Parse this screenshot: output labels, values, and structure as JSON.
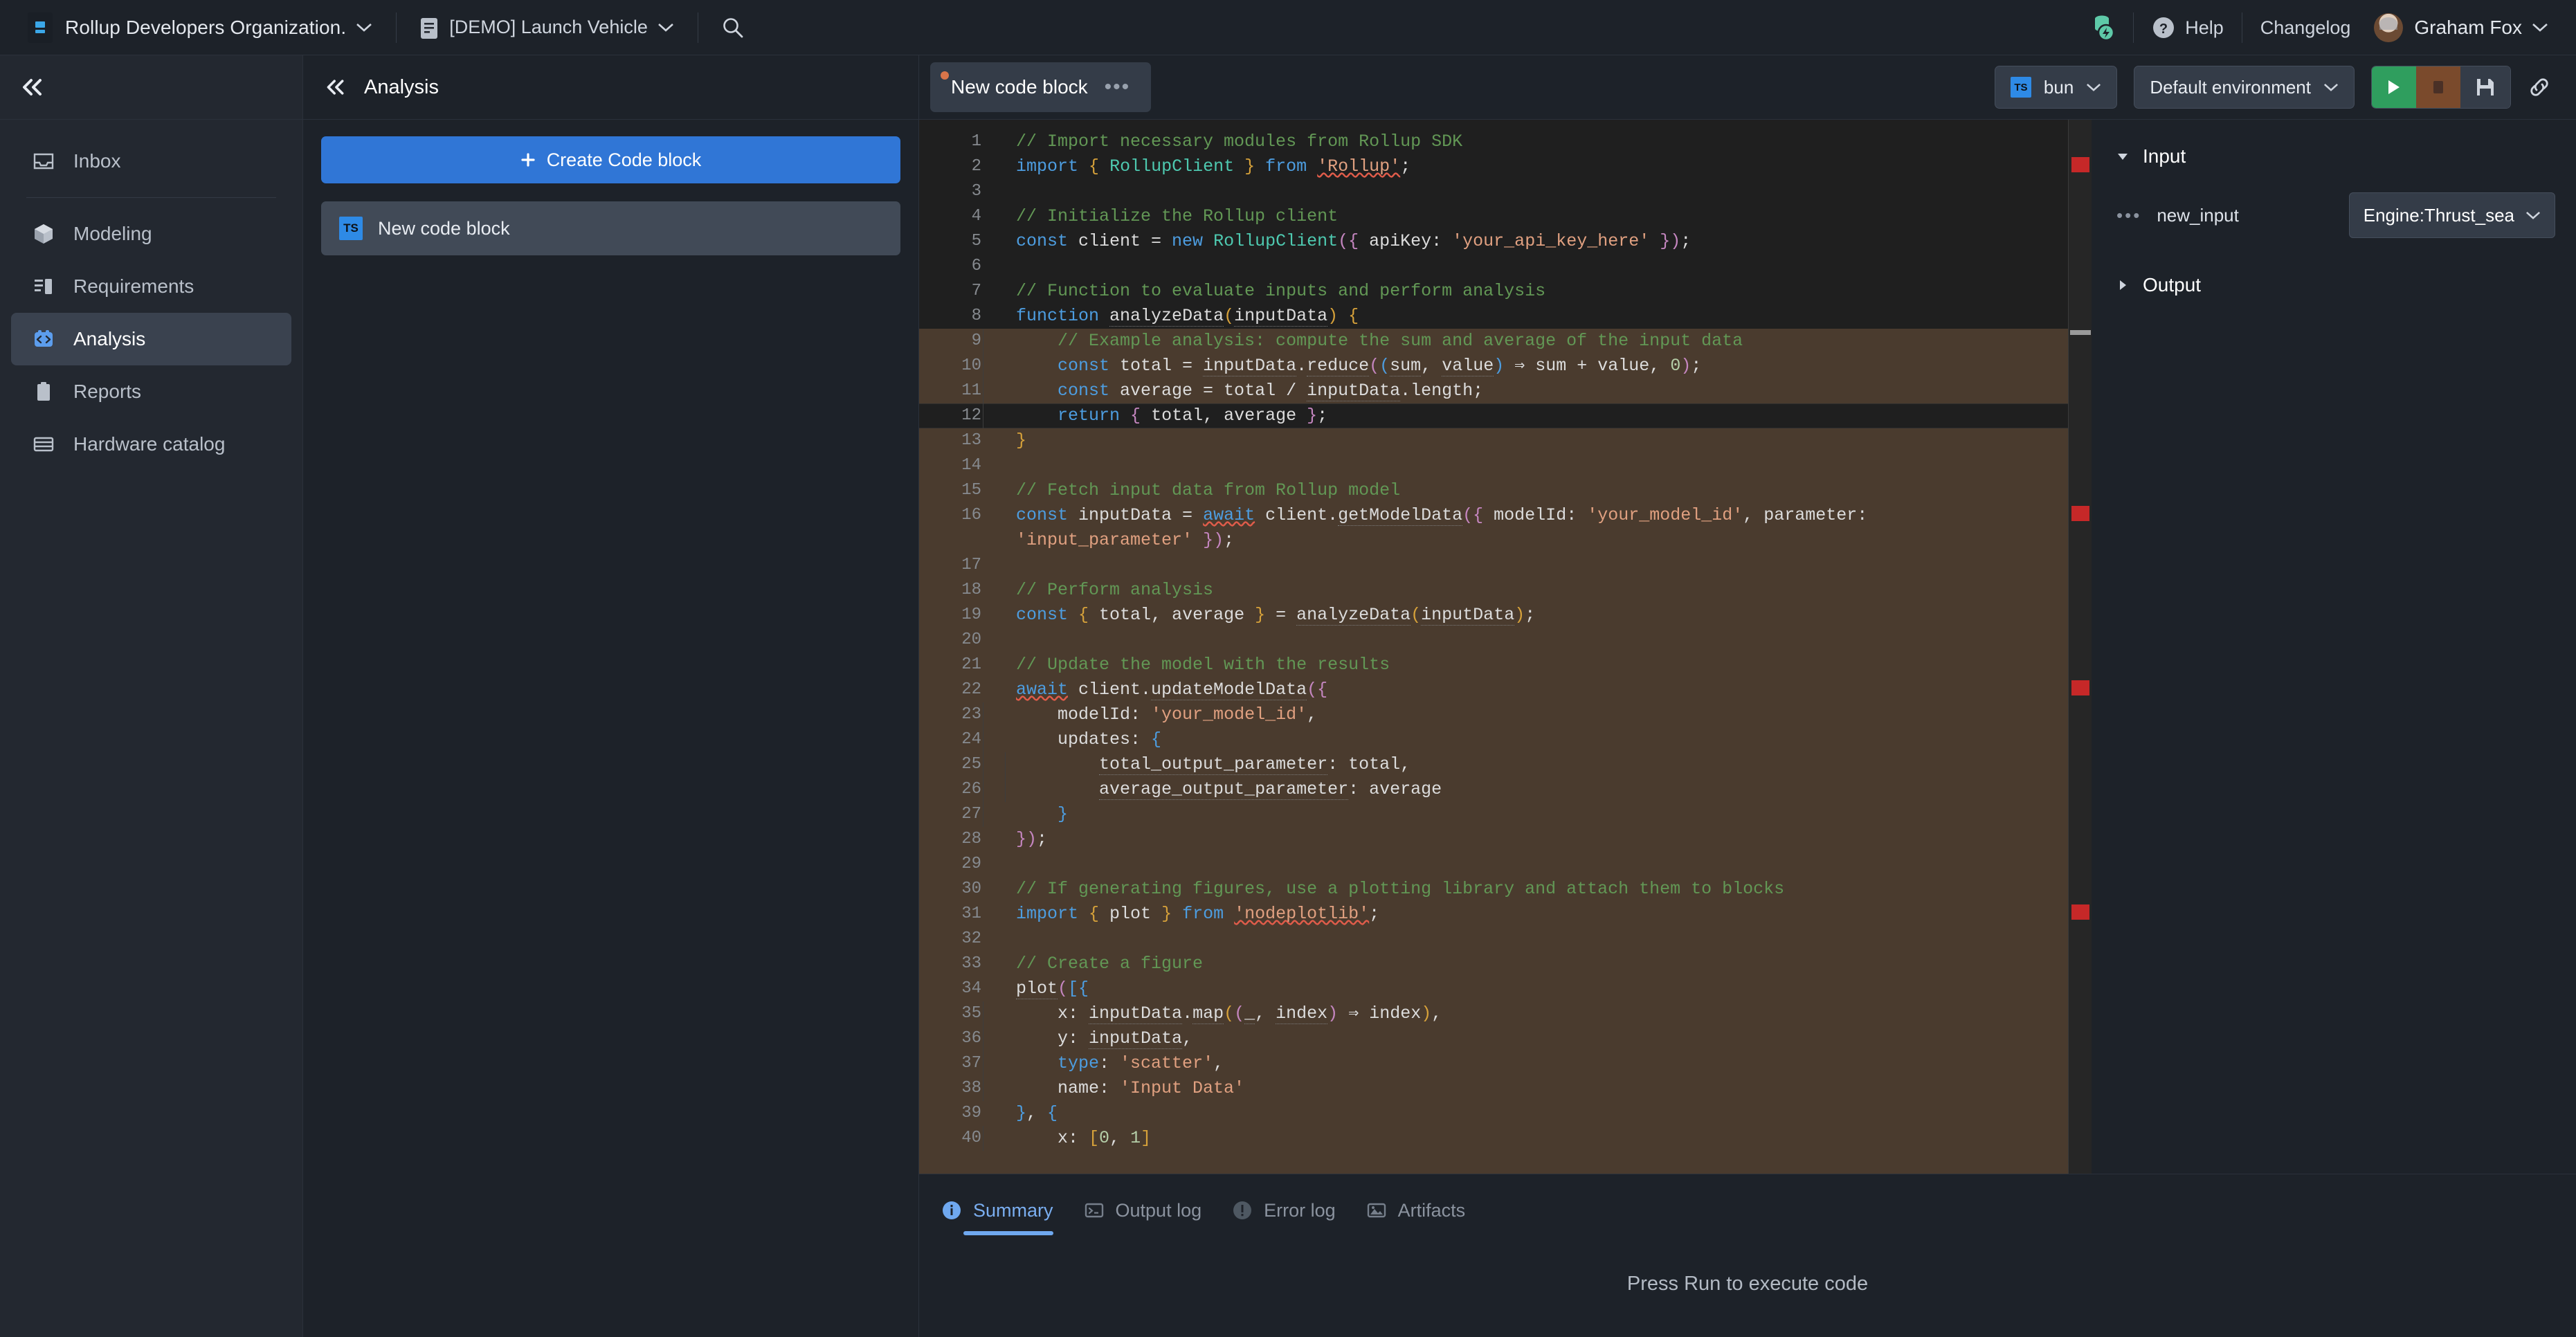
{
  "topbar": {
    "org_logo_icon": "rollup-logo-icon",
    "org_name": "Rollup Developers Organization.",
    "org_chevron_icon": "chevron-down-icon",
    "project_doc_icon": "document-icon",
    "project_name": "[DEMO] Launch Vehicle",
    "project_chevron_icon": "chevron-down-icon",
    "search_icon": "search-icon",
    "integration_icon": "database-bolt-icon",
    "help_icon": "help-circle-icon",
    "help_label": "Help",
    "changelog_label": "Changelog",
    "avatar_icon": "avatar",
    "user_name": "Graham Fox",
    "user_chevron_icon": "chevron-down-icon"
  },
  "sidebar": {
    "collapse_icon": "double-chevron-left-icon",
    "items": [
      {
        "label": "Inbox",
        "icon": "inbox-icon",
        "active": false
      },
      {
        "label": "Modeling",
        "icon": "cube-icon",
        "active": false
      },
      {
        "label": "Requirements",
        "icon": "requirements-list-icon",
        "active": false
      },
      {
        "label": "Analysis",
        "icon": "code-brackets-icon",
        "active": true
      },
      {
        "label": "Reports",
        "icon": "clipboard-icon",
        "active": false
      },
      {
        "label": "Hardware catalog",
        "icon": "table-rows-icon",
        "active": false
      }
    ]
  },
  "analysis_panel": {
    "collapse_icon": "double-chevron-left-icon",
    "title": "Analysis",
    "create_button_label": "Create Code block",
    "create_button_icon": "plus-icon",
    "create_button_color": "#3076d6",
    "blocks": [
      {
        "label": "New code block",
        "badge": "TS",
        "badge_color": "#2e8ae6",
        "selected": true
      }
    ]
  },
  "editor_toolbar": {
    "tab_label": "New code block",
    "tab_unsaved_dot_color": "#d9754a",
    "tab_menu_icon": "ellipsis-icon",
    "runtime_badge": "TS",
    "runtime_label": "bun",
    "runtime_chevron_icon": "chevron-down-icon",
    "environment_label": "Default environment",
    "environment_chevron_icon": "chevron-down-icon",
    "run_icon": "play-icon",
    "run_color": "#2f9e5e",
    "stop_icon": "stop-icon",
    "stop_color": "#7a4a2c",
    "save_icon": "floppy-disk-icon",
    "link_icon": "link-icon"
  },
  "editor": {
    "language": "typescript",
    "selection_start_line": 9,
    "current_line": 12,
    "error_marker_color": "#c62828",
    "error_marker_lines": [
      2,
      16,
      22,
      31
    ],
    "lines": [
      {
        "n": 1,
        "tokens": [
          {
            "t": "// Import necessary modules from Rollup SDK",
            "c": "cm"
          }
        ]
      },
      {
        "n": 2,
        "tokens": [
          {
            "t": "import",
            "c": "kw"
          },
          {
            "t": " ",
            "c": "pl"
          },
          {
            "t": "{",
            "c": "br1"
          },
          {
            "t": " ",
            "c": "pl"
          },
          {
            "t": "RollupClient",
            "c": "ty"
          },
          {
            "t": " ",
            "c": "pl"
          },
          {
            "t": "}",
            "c": "br1"
          },
          {
            "t": " ",
            "c": "pl"
          },
          {
            "t": "from",
            "c": "kw"
          },
          {
            "t": " ",
            "c": "pl"
          },
          {
            "t": "'Rollup'",
            "c": "st sq"
          },
          {
            "t": ";",
            "c": "pl"
          }
        ]
      },
      {
        "n": 3,
        "tokens": []
      },
      {
        "n": 4,
        "tokens": [
          {
            "t": "// Initialize the Rollup client",
            "c": "cm"
          }
        ]
      },
      {
        "n": 5,
        "tokens": [
          {
            "t": "const",
            "c": "kw"
          },
          {
            "t": " client = ",
            "c": "pl"
          },
          {
            "t": "new",
            "c": "kw"
          },
          {
            "t": " ",
            "c": "pl"
          },
          {
            "t": "RollupClient",
            "c": "ty"
          },
          {
            "t": "(",
            "c": "br2"
          },
          {
            "t": "{",
            "c": "br2"
          },
          {
            "t": " apiKey: ",
            "c": "pl"
          },
          {
            "t": "'your_api_key_here'",
            "c": "st"
          },
          {
            "t": " ",
            "c": "pl"
          },
          {
            "t": "}",
            "c": "br2"
          },
          {
            "t": ")",
            "c": "br2"
          },
          {
            "t": ";",
            "c": "pl"
          }
        ]
      },
      {
        "n": 6,
        "tokens": []
      },
      {
        "n": 7,
        "tokens": [
          {
            "t": "// Function to evaluate inputs and perform analysis",
            "c": "cm"
          }
        ]
      },
      {
        "n": 8,
        "tokens": [
          {
            "t": "function",
            "c": "kw"
          },
          {
            "t": " ",
            "c": "pl"
          },
          {
            "t": "analyzeData",
            "c": "pl dd"
          },
          {
            "t": "(",
            "c": "br1"
          },
          {
            "t": "inputData",
            "c": "pl dd"
          },
          {
            "t": ")",
            "c": "br1"
          },
          {
            "t": " ",
            "c": "pl"
          },
          {
            "t": "{",
            "c": "br1"
          }
        ]
      },
      {
        "n": 9,
        "indent": 1,
        "tokens": [
          {
            "t": "    // Example analysis: compute the sum and average of the input data",
            "c": "cm"
          }
        ]
      },
      {
        "n": 10,
        "indent": 1,
        "tokens": [
          {
            "t": "    ",
            "c": "pl"
          },
          {
            "t": "const",
            "c": "kw"
          },
          {
            "t": " total = ",
            "c": "pl"
          },
          {
            "t": "inputData",
            "c": "pl dd"
          },
          {
            "t": ".",
            "c": "pl"
          },
          {
            "t": "reduce",
            "c": "pl dd"
          },
          {
            "t": "(",
            "c": "br2"
          },
          {
            "t": "(",
            "c": "br3"
          },
          {
            "t": "sum",
            "c": "pl dd"
          },
          {
            "t": ", ",
            "c": "pl"
          },
          {
            "t": "value",
            "c": "pl dd"
          },
          {
            "t": ")",
            "c": "br3"
          },
          {
            "t": " ⇒ sum + value, ",
            "c": "pl"
          },
          {
            "t": "0",
            "c": "nm"
          },
          {
            "t": ")",
            "c": "br2"
          },
          {
            "t": ";",
            "c": "pl"
          }
        ]
      },
      {
        "n": 11,
        "indent": 1,
        "tokens": [
          {
            "t": "    ",
            "c": "pl"
          },
          {
            "t": "const",
            "c": "kw"
          },
          {
            "t": " average = total / ",
            "c": "pl"
          },
          {
            "t": "inputData",
            "c": "pl dd"
          },
          {
            "t": ".length;",
            "c": "pl"
          }
        ]
      },
      {
        "n": 12,
        "indent": 1,
        "tokens": [
          {
            "t": "    ",
            "c": "pl"
          },
          {
            "t": "return",
            "c": "kw"
          },
          {
            "t": " ",
            "c": "pl"
          },
          {
            "t": "{",
            "c": "br2"
          },
          {
            "t": " total, average ",
            "c": "pl"
          },
          {
            "t": "}",
            "c": "br2"
          },
          {
            "t": ";",
            "c": "pl"
          }
        ]
      },
      {
        "n": 13,
        "tokens": [
          {
            "t": "}",
            "c": "br1"
          }
        ]
      },
      {
        "n": 14,
        "tokens": []
      },
      {
        "n": 15,
        "tokens": [
          {
            "t": "// Fetch input data from Rollup model",
            "c": "cm"
          }
        ]
      },
      {
        "n": 16,
        "tokens": [
          {
            "t": "const",
            "c": "kw"
          },
          {
            "t": " inputData = ",
            "c": "pl"
          },
          {
            "t": "await",
            "c": "kw sq"
          },
          {
            "t": " client.",
            "c": "pl"
          },
          {
            "t": "getModelData",
            "c": "pl dd"
          },
          {
            "t": "(",
            "c": "br2"
          },
          {
            "t": "{",
            "c": "br2"
          },
          {
            "t": " modelId: ",
            "c": "pl"
          },
          {
            "t": "'your_model_id'",
            "c": "st"
          },
          {
            "t": ", parameter:",
            "c": "pl"
          }
        ]
      },
      {
        "n": null,
        "cont": true,
        "tokens": [
          {
            "t": "'input_parameter'",
            "c": "st"
          },
          {
            "t": " ",
            "c": "pl"
          },
          {
            "t": "}",
            "c": "br2"
          },
          {
            "t": ")",
            "c": "br2"
          },
          {
            "t": ";",
            "c": "pl"
          }
        ]
      },
      {
        "n": 17,
        "tokens": []
      },
      {
        "n": 18,
        "tokens": [
          {
            "t": "// Perform analysis",
            "c": "cm"
          }
        ]
      },
      {
        "n": 19,
        "tokens": [
          {
            "t": "const",
            "c": "kw"
          },
          {
            "t": " ",
            "c": "pl"
          },
          {
            "t": "{",
            "c": "br1"
          },
          {
            "t": " total, average ",
            "c": "pl"
          },
          {
            "t": "}",
            "c": "br1"
          },
          {
            "t": " = ",
            "c": "pl"
          },
          {
            "t": "analyzeData",
            "c": "pl dd"
          },
          {
            "t": "(",
            "c": "br1"
          },
          {
            "t": "inputData",
            "c": "pl dd"
          },
          {
            "t": ")",
            "c": "br1"
          },
          {
            "t": ";",
            "c": "pl"
          }
        ]
      },
      {
        "n": 20,
        "tokens": []
      },
      {
        "n": 21,
        "tokens": [
          {
            "t": "// Update the model with the results",
            "c": "cm"
          }
        ]
      },
      {
        "n": 22,
        "tokens": [
          {
            "t": "await",
            "c": "kw sq"
          },
          {
            "t": " client.",
            "c": "pl"
          },
          {
            "t": "updateModelData",
            "c": "pl dd"
          },
          {
            "t": "(",
            "c": "br2"
          },
          {
            "t": "{",
            "c": "br2"
          }
        ]
      },
      {
        "n": 23,
        "indent": 1,
        "tokens": [
          {
            "t": "    modelId: ",
            "c": "pl"
          },
          {
            "t": "'your_model_id'",
            "c": "st"
          },
          {
            "t": ",",
            "c": "pl"
          }
        ]
      },
      {
        "n": 24,
        "indent": 1,
        "tokens": [
          {
            "t": "    updates: ",
            "c": "pl"
          },
          {
            "t": "{",
            "c": "br3"
          }
        ]
      },
      {
        "n": 25,
        "indent": 2,
        "tokens": [
          {
            "t": "        ",
            "c": "pl"
          },
          {
            "t": "total_output_parameter",
            "c": "pl dd"
          },
          {
            "t": ": total,",
            "c": "pl"
          }
        ]
      },
      {
        "n": 26,
        "indent": 2,
        "tokens": [
          {
            "t": "        ",
            "c": "pl"
          },
          {
            "t": "average_output_parameter",
            "c": "pl dd"
          },
          {
            "t": ": average",
            "c": "pl"
          }
        ]
      },
      {
        "n": 27,
        "indent": 1,
        "tokens": [
          {
            "t": "    ",
            "c": "pl"
          },
          {
            "t": "}",
            "c": "br3"
          }
        ]
      },
      {
        "n": 28,
        "tokens": [
          {
            "t": "}",
            "c": "br2"
          },
          {
            "t": ")",
            "c": "br2"
          },
          {
            "t": ";",
            "c": "pl"
          }
        ]
      },
      {
        "n": 29,
        "tokens": []
      },
      {
        "n": 30,
        "tokens": [
          {
            "t": "// If generating figures, use a plotting library and attach them to blocks",
            "c": "cm"
          }
        ]
      },
      {
        "n": 31,
        "tokens": [
          {
            "t": "import",
            "c": "kw"
          },
          {
            "t": " ",
            "c": "pl"
          },
          {
            "t": "{",
            "c": "br1"
          },
          {
            "t": " plot ",
            "c": "pl"
          },
          {
            "t": "}",
            "c": "br1"
          },
          {
            "t": " ",
            "c": "pl"
          },
          {
            "t": "from",
            "c": "kw"
          },
          {
            "t": " ",
            "c": "pl"
          },
          {
            "t": "'nodeplotlib'",
            "c": "st sq"
          },
          {
            "t": ";",
            "c": "pl"
          }
        ]
      },
      {
        "n": 32,
        "tokens": []
      },
      {
        "n": 33,
        "tokens": [
          {
            "t": "// Create a figure",
            "c": "cm"
          }
        ]
      },
      {
        "n": 34,
        "tokens": [
          {
            "t": "plot",
            "c": "pl dd"
          },
          {
            "t": "(",
            "c": "br2"
          },
          {
            "t": "[",
            "c": "br3"
          },
          {
            "t": "{",
            "c": "br3"
          }
        ]
      },
      {
        "n": 35,
        "indent": 1,
        "tokens": [
          {
            "t": "    x: ",
            "c": "pl"
          },
          {
            "t": "inputData",
            "c": "pl dd"
          },
          {
            "t": ".",
            "c": "pl"
          },
          {
            "t": "map",
            "c": "pl dd"
          },
          {
            "t": "(",
            "c": "br1"
          },
          {
            "t": "(",
            "c": "br2"
          },
          {
            "t": "_",
            "c": "pl dd"
          },
          {
            "t": ", ",
            "c": "pl"
          },
          {
            "t": "index",
            "c": "pl dd"
          },
          {
            "t": ")",
            "c": "br2"
          },
          {
            "t": " ⇒ index",
            "c": "pl"
          },
          {
            "t": ")",
            "c": "br1"
          },
          {
            "t": ",",
            "c": "pl"
          }
        ]
      },
      {
        "n": 36,
        "indent": 1,
        "tokens": [
          {
            "t": "    y: ",
            "c": "pl"
          },
          {
            "t": "inputData",
            "c": "pl dd"
          },
          {
            "t": ",",
            "c": "pl"
          }
        ]
      },
      {
        "n": 37,
        "indent": 1,
        "tokens": [
          {
            "t": "    ",
            "c": "pl"
          },
          {
            "t": "type",
            "c": "kw"
          },
          {
            "t": ": ",
            "c": "pl"
          },
          {
            "t": "'scatter'",
            "c": "st"
          },
          {
            "t": ",",
            "c": "pl"
          }
        ]
      },
      {
        "n": 38,
        "indent": 1,
        "tokens": [
          {
            "t": "    name: ",
            "c": "pl"
          },
          {
            "t": "'Input Data'",
            "c": "st"
          }
        ]
      },
      {
        "n": 39,
        "tokens": [
          {
            "t": "}",
            "c": "br3"
          },
          {
            "t": ", ",
            "c": "pl"
          },
          {
            "t": "{",
            "c": "br3"
          }
        ]
      },
      {
        "n": 40,
        "indent": 1,
        "tokens": [
          {
            "t": "    x: ",
            "c": "pl"
          },
          {
            "t": "[",
            "c": "br1"
          },
          {
            "t": "0",
            "c": "nm"
          },
          {
            "t": ", ",
            "c": "pl"
          },
          {
            "t": "1",
            "c": "nm"
          },
          {
            "t": "]",
            "c": "br1"
          }
        ]
      }
    ]
  },
  "io_panel": {
    "input": {
      "label": "Input",
      "expanded": true,
      "triangle_icon": "triangle-down-icon",
      "rows": [
        {
          "name": "new_input",
          "handle_icon": "drag-dots-icon",
          "value": "Engine:Thrust_sea",
          "chevron_icon": "chevron-down-icon"
        }
      ]
    },
    "output": {
      "label": "Output",
      "expanded": false,
      "triangle_icon": "triangle-right-icon"
    }
  },
  "bottom_panel": {
    "tabs": [
      {
        "label": "Summary",
        "icon": "info-circle-icon",
        "active": true
      },
      {
        "label": "Output log",
        "icon": "terminal-icon",
        "active": false
      },
      {
        "label": "Error log",
        "icon": "exclamation-circle-icon",
        "active": false
      },
      {
        "label": "Artifacts",
        "icon": "image-icon",
        "active": false
      }
    ],
    "message": "Press Run to execute code",
    "active_tab_color": "#6fa8ef"
  }
}
